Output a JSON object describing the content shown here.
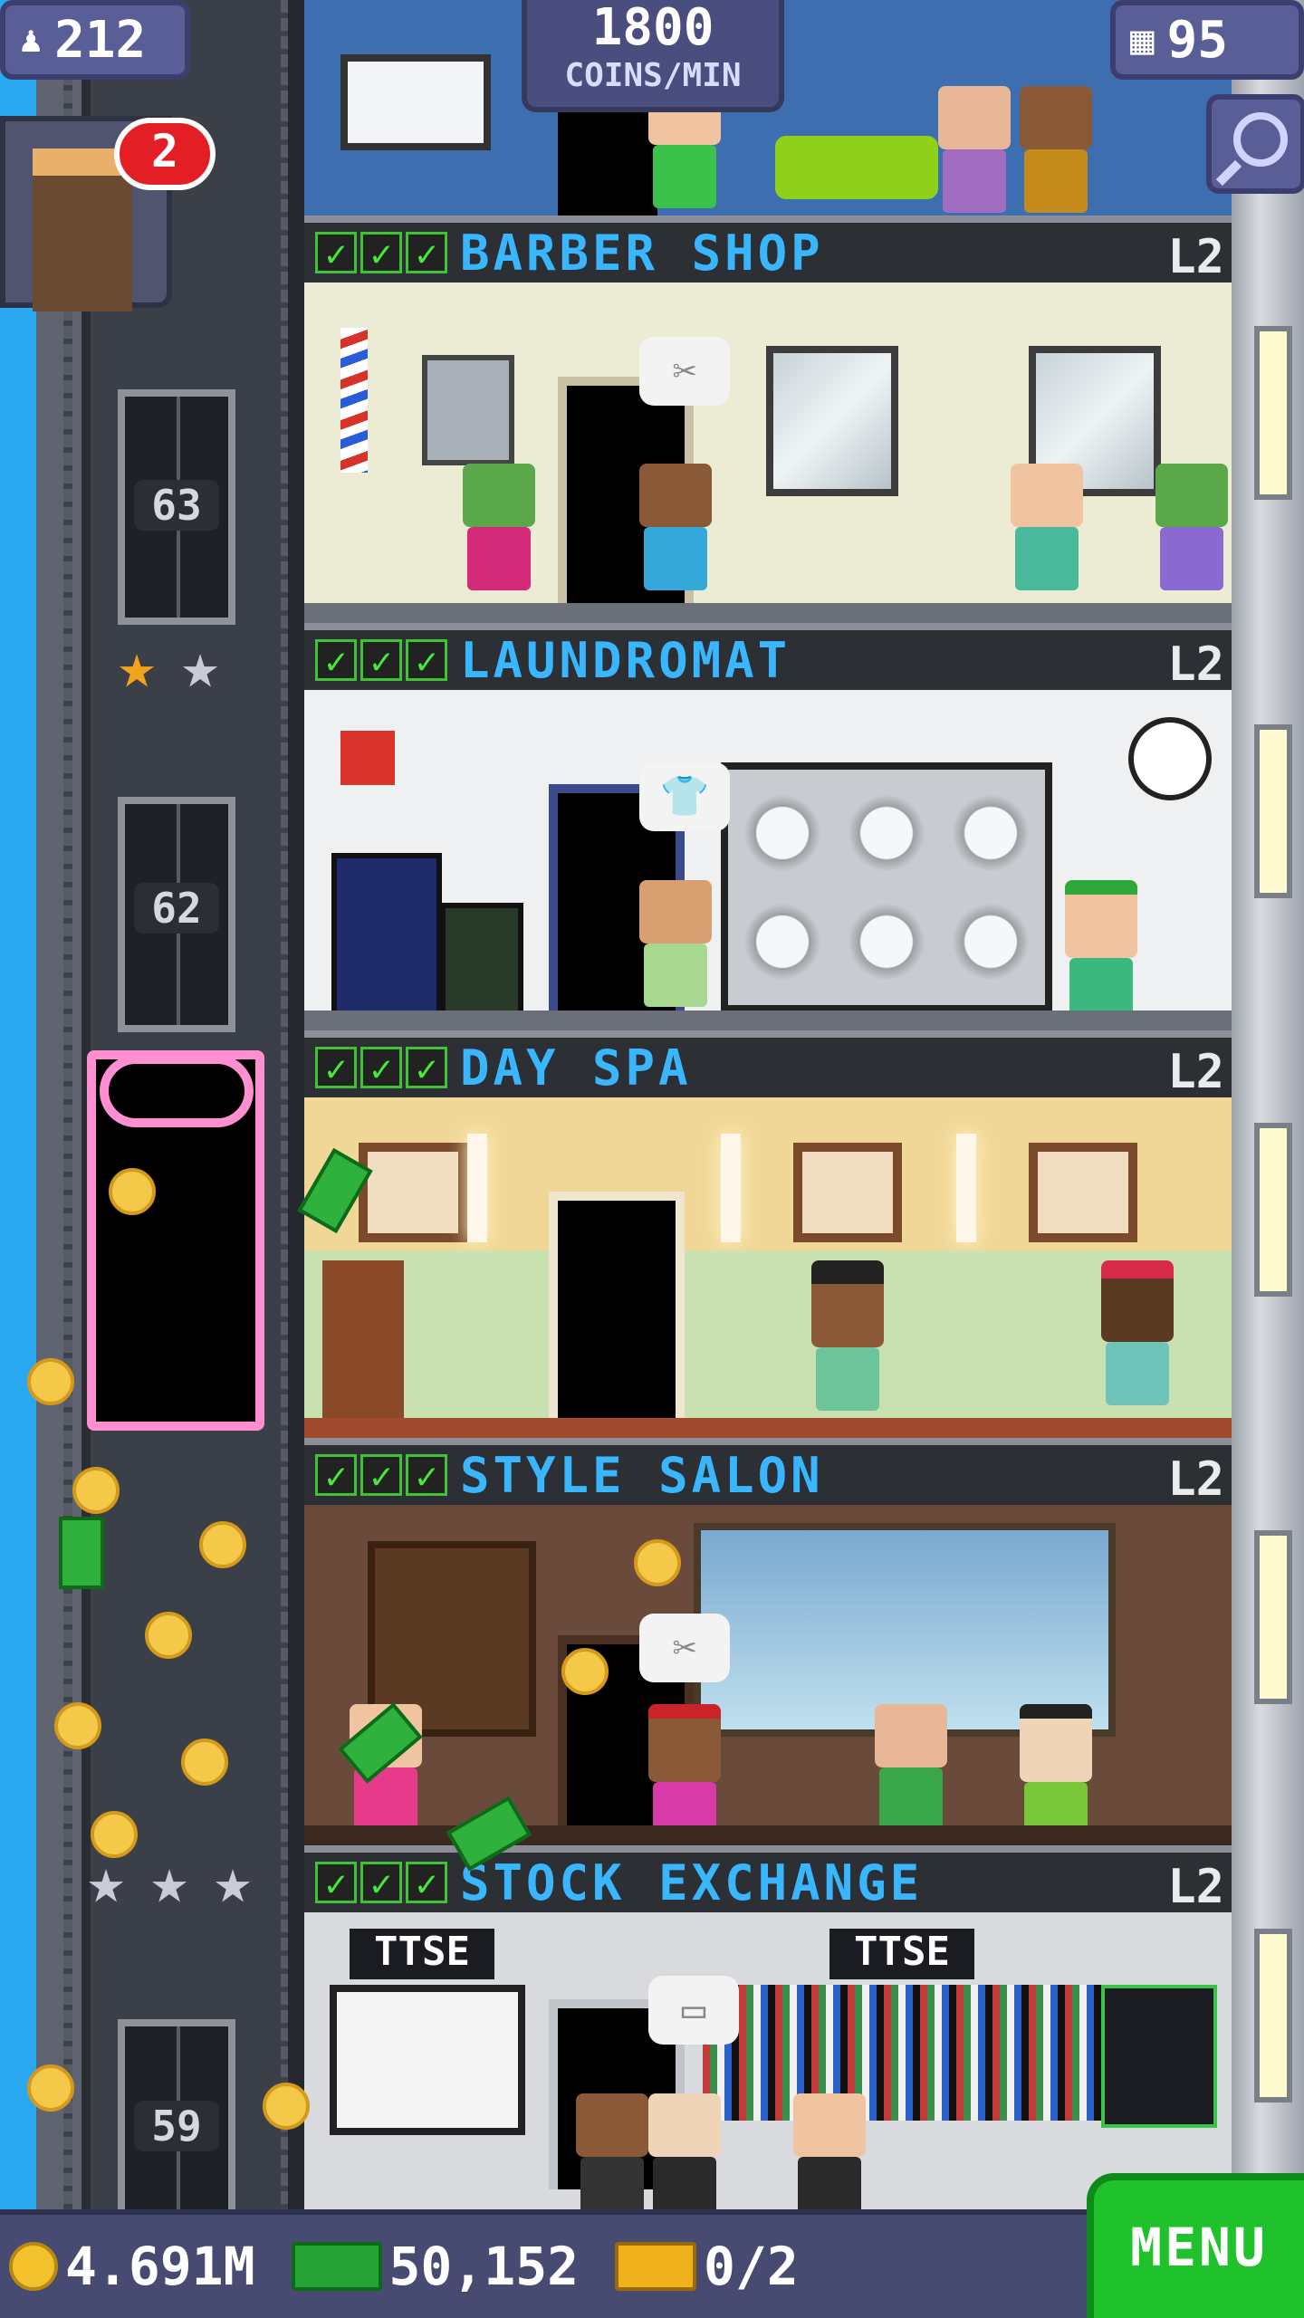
{
  "hud": {
    "population": "212",
    "coins_per_min_value": "1800",
    "coins_per_min_unit": "COINS/MIN",
    "floors_count": "95",
    "notification_count": "2"
  },
  "elevator": {
    "floor_numbers": [
      "63",
      "62",
      "59"
    ]
  },
  "floors": [
    {
      "name": "BARBER SHOP",
      "level": "L2",
      "checks": 3
    },
    {
      "name": "LAUNDROMAT",
      "level": "L2",
      "checks": 3
    },
    {
      "name": "DAY SPA",
      "level": "L2",
      "checks": 3
    },
    {
      "name": "STYLE SALON",
      "level": "L2",
      "checks": 3
    },
    {
      "name": "STOCK EXCHANGE",
      "level": "L2",
      "checks": 3
    }
  ],
  "stock_exchange": {
    "ticker_left": "TTSE",
    "ticker_right": "TTSE"
  },
  "bottom_bar": {
    "coins": "4.691M",
    "bux": "50,152",
    "chests": "0/2",
    "menu_label": "MENU"
  },
  "colors": {
    "floor_name": "#3ab6ff",
    "check": "#46e83a",
    "menu": "#1fc22a",
    "badge": "#5a5e96"
  }
}
